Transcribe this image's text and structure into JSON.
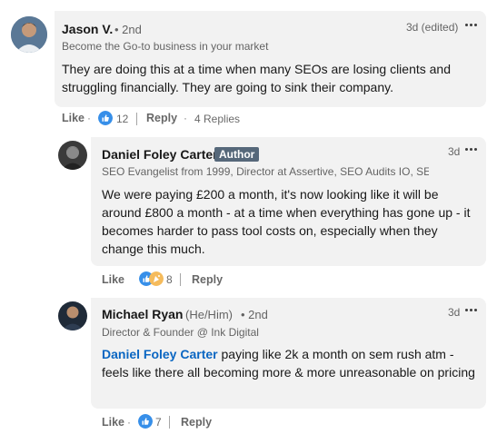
{
  "comments": [
    {
      "author": "Jason V.",
      "degree": "• 2nd",
      "headline": "Become the Go-to business in your market",
      "time": "3d (edited)",
      "text": "They are doing this at a time when many SEOs are losing clients and struggling financially. They are going to sink their company.",
      "like_label": "Like",
      "reaction_count": "12",
      "reply_label": "Reply",
      "replies_label": "4 Replies"
    },
    {
      "author": "Daniel Foley Carter",
      "badge": "Author",
      "headline": "SEO Evangelist from 1999, Director at Assertive, SEO Audits IO, SE...",
      "time": "3d",
      "text": "We were paying £200 a month, it's now looking like it will be around £800 a month - at a time when everything has gone up - it becomes harder to pass tool costs on, especially when they change this much.",
      "like_label": "Like",
      "reaction_count": "8",
      "reply_label": "Reply"
    },
    {
      "author": "Michael Ryan",
      "pronouns": "(He/Him)",
      "degree": "• 2nd",
      "headline": "Director & Founder @ Ink Digital",
      "time": "3d",
      "mention": "Daniel Foley Carter",
      "text": " paying like 2k a month on sem rush atm - feels like there all becoming more & more unreasonable on pricing",
      "like_label": "Like",
      "reaction_count": "7",
      "reply_label": "Reply"
    }
  ],
  "colors": {
    "bubble": "#f2f2f2",
    "link": "#0a66c2",
    "author_badge": "#56687a",
    "like_reaction": "#378fe9",
    "celebrate_reaction": "#f5bb5c"
  },
  "icons": [
    "more-options-icon",
    "like-reaction-icon",
    "celebrate-reaction-icon"
  ]
}
